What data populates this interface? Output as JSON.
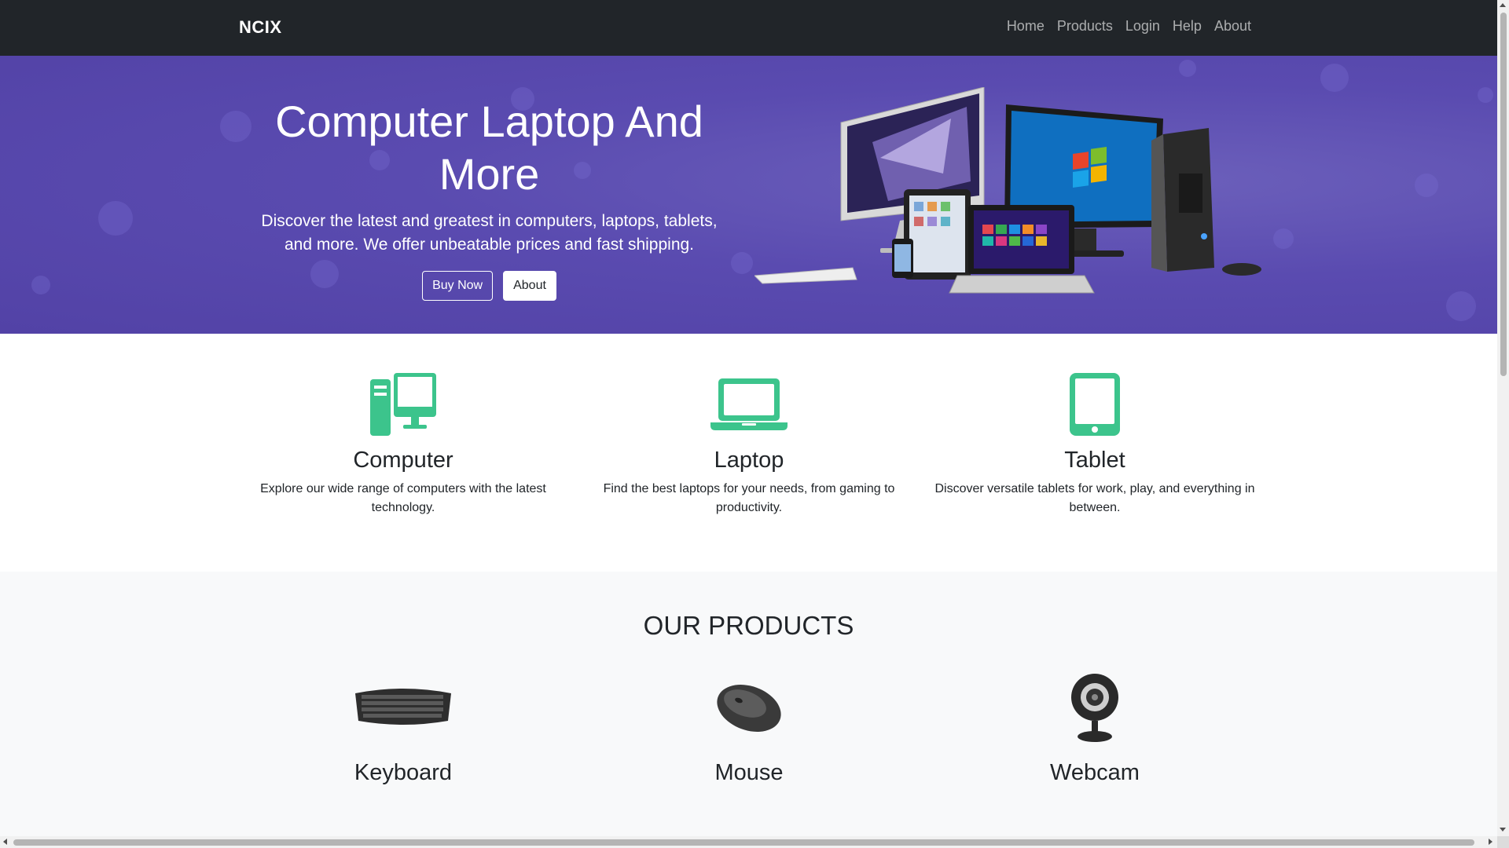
{
  "navbar": {
    "brand": "NCIX",
    "links": [
      "Home",
      "Products",
      "Login",
      "Help",
      "About"
    ]
  },
  "hero": {
    "title": "Computer Laptop And More",
    "subtitle": "Discover the latest and greatest in computers, laptops, tablets, and more. We offer unbeatable prices and fast shipping.",
    "primary_button": "Buy Now",
    "secondary_button": "About"
  },
  "features": [
    {
      "icon": "desktop-icon",
      "title": "Computer",
      "description": "Explore our wide range of computers with the latest technology."
    },
    {
      "icon": "laptop-icon",
      "title": "Laptop",
      "description": "Find the best laptops for your needs, from gaming to productivity."
    },
    {
      "icon": "tablet-icon",
      "title": "Tablet",
      "description": "Discover versatile tablets for work, play, and everything in between."
    }
  ],
  "products": {
    "heading": "OUR PRODUCTS",
    "items": [
      {
        "name": "Keyboard",
        "icon": "keyboard-image"
      },
      {
        "name": "Mouse",
        "icon": "mouse-image"
      },
      {
        "name": "Webcam",
        "icon": "webcam-image"
      }
    ]
  },
  "colors": {
    "navbar_bg": "#212529",
    "hero_bg": "#5848a8",
    "accent_green": "#3cc48c",
    "products_bg": "#f8f9fa"
  }
}
